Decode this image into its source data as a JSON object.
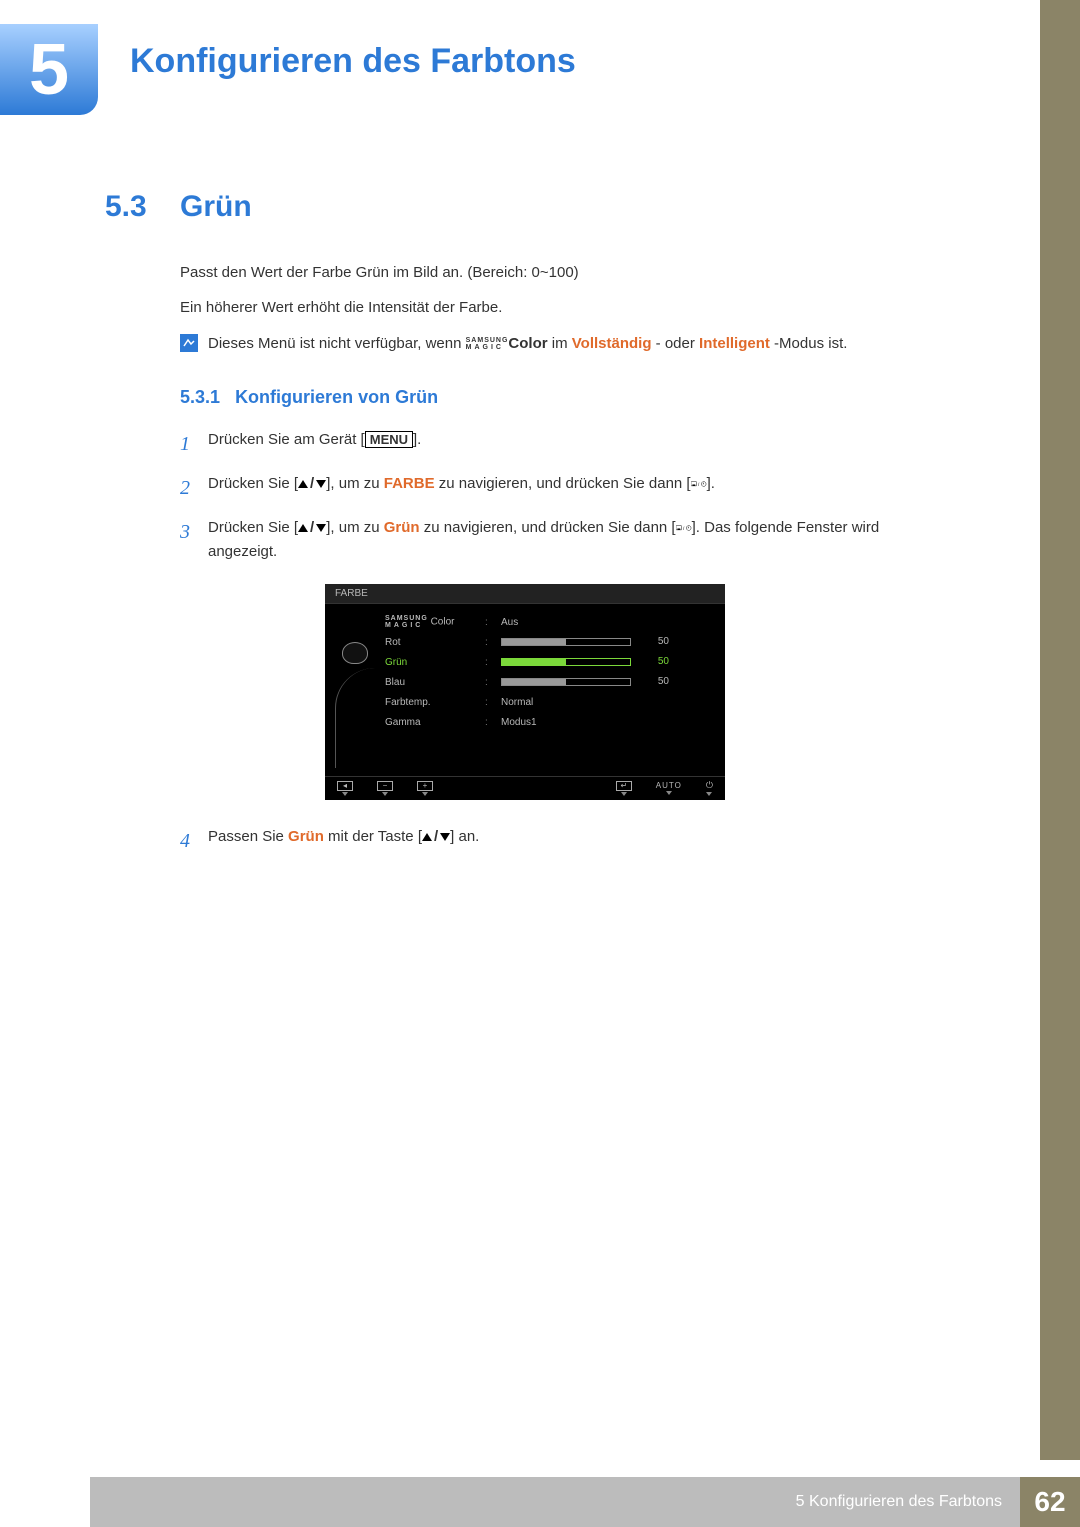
{
  "chapter": {
    "number": "5",
    "title": "Konfigurieren des Farbtons"
  },
  "section": {
    "number": "5.3",
    "title": "Grün"
  },
  "intro": {
    "p1": "Passt den Wert der Farbe Grün im Bild an. (Bereich: 0~100)",
    "p2": "Ein höherer Wert erhöht die Intensität der Farbe."
  },
  "note": {
    "pre": "Dieses Menü ist nicht verfügbar, wenn ",
    "magic_top": "SAMSUNG",
    "magic_bottom": "MAGIC",
    "color_word": "Color",
    "mid1": " im ",
    "mode1": "Vollständig",
    "mid2": "- oder ",
    "mode2": "Intelligent",
    "post": "-Modus ist."
  },
  "subsection": {
    "number": "5.3.1",
    "title": "Konfigurieren von Grün"
  },
  "steps": {
    "s1": {
      "num": "1",
      "pre": "Drücken Sie am Gerät [",
      "btn": "MENU",
      "post": "]."
    },
    "s2": {
      "num": "2",
      "pre": "Drücken Sie [",
      "mid1": "], um zu ",
      "target": "FARBE",
      "mid2": " zu navigieren, und drücken Sie dann [",
      "post": "]."
    },
    "s3": {
      "num": "3",
      "pre": "Drücken Sie [",
      "mid1": "], um zu ",
      "target": "Grün",
      "mid2": " zu navigieren, und drücken Sie dann [",
      "post": "]. Das folgende Fenster wird angezeigt."
    },
    "s4": {
      "num": "4",
      "pre": "Passen Sie ",
      "target": "Grün",
      "mid": " mit der Taste [",
      "post": "] an."
    }
  },
  "osd": {
    "title": "FARBE",
    "rows": {
      "magic": {
        "value": "Aus"
      },
      "rot": {
        "label": "Rot",
        "value": "50",
        "fill": 50
      },
      "gruen": {
        "label": "Grün",
        "value": "50",
        "fill": 50
      },
      "blau": {
        "label": "Blau",
        "value": "50",
        "fill": 50
      },
      "farbtemp": {
        "label": "Farbtemp.",
        "value": "Normal"
      },
      "gamma": {
        "label": "Gamma",
        "value": "Modus1"
      }
    },
    "footer": {
      "auto": "AUTO"
    }
  },
  "footer": {
    "text": "5 Konfigurieren des Farbtons",
    "page": "62"
  },
  "chart_data": {
    "type": "table",
    "title": "FARBE OSD Einstellungen",
    "rows": [
      {
        "setting": "SAMSUNG MAGIC Color",
        "value": "Aus"
      },
      {
        "setting": "Rot",
        "value": 50,
        "range": [
          0,
          100
        ]
      },
      {
        "setting": "Grün",
        "value": 50,
        "range": [
          0,
          100
        ],
        "active": true
      },
      {
        "setting": "Blau",
        "value": 50,
        "range": [
          0,
          100
        ]
      },
      {
        "setting": "Farbtemp.",
        "value": "Normal"
      },
      {
        "setting": "Gamma",
        "value": "Modus1"
      }
    ]
  }
}
